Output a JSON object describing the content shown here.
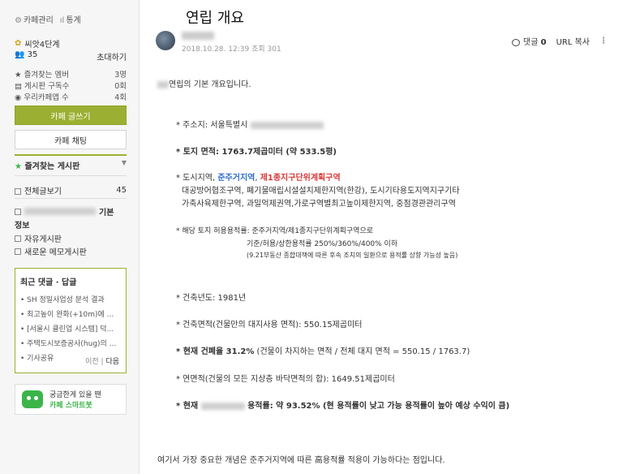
{
  "sidebar": {
    "cafe_manage": "카페관리",
    "stats": "통계",
    "level": "씨앗4단계",
    "member_count": "35",
    "invite": "초대하기",
    "stats_rows": [
      {
        "label": "즐겨찾는 멤버",
        "value": "3명"
      },
      {
        "label": "게시판 구독수",
        "value": "0회"
      },
      {
        "label": "우리카페앱 수",
        "value": "4회"
      }
    ],
    "write_btn": "카페 글쓰기",
    "chat_btn": "카페 채팅",
    "fav_boards": "즐겨찾는 게시판",
    "all_posts": "전체글보기",
    "all_posts_count": "45",
    "board_basic": "기본",
    "board_info": "정보",
    "board_free": "자유게시판",
    "board_memo": "새로운 메모게시판",
    "recent_title": "최근 댓글 · 답글",
    "recent_items": [
      "SH 정밀사업성 분석 결과",
      "최고높이 완화(+10m)에 ...",
      "[서울시 클린업 시스템] 덕...",
      "주택도시보증공사(hug)의 ...",
      "기사공유"
    ],
    "prev": "이전",
    "next": "다음",
    "smart_line1": "궁금한게 있을 땐",
    "smart_line2": "카페 스마트봇",
    "accent": "#9bb032"
  },
  "post": {
    "title": "연립 개요",
    "date": "2018.10.28. 12:39",
    "views": "조회 301",
    "comment_label": "댓글",
    "comment_count": "0",
    "url_copy": "URL 복사",
    "intro": "연립의 기본 개요입니다.",
    "addr": "* 주소지: 서울특별시",
    "land_area": "* 토지 면적: 1763.7제곱미터 (약 533.5평)",
    "zone_prefix": "* 도시지역, ",
    "zone_blue": "준주거지역",
    "zone_red": "제1종지구단위계획구역",
    "zone_line2": "대공방어협조구역, 폐기물매립시설설치제한지역(한강), 도시기타용도지역지구기타",
    "zone_line3": "가축사육제한구역, 과밀억제권역,가로구역별최고높이제한지역, 중점경관관리구역",
    "far_line1": "* 해당 토지 허용용적률: 준주거지역/제1종지구단위계획구역으로",
    "far_line2": "기준/허용/상한용적률 250%/360%/400% 이하",
    "far_line3": "(9.21부동산 종합대책에 따른 후속 조치의 일환으로 용적률 상향 가능성 높음)",
    "built_year": "* 건축년도: 1981년",
    "building_area": "* 건축면적(건물만의 대지사용 면적): 550.15제곱미터",
    "bcr_bold": "* 현재 건폐율 31.2%",
    "bcr_rest": " (건물이 차지하는 면적 / 전체 대지 면적 = 550.15 / 1763.7)",
    "gfa": "* 연면적(건물의 모든 지상층 바닥면적의 합): 1649.51제곱미터",
    "far_now_prefix": "* 현재",
    "far_now_rest": "용적률: 약 93.52% (현 용적률이 낮고 가능 용적률이 높아 예상 수익이 큼)",
    "conclusion": "여기서 가장 중요한 개념은 준주거지역에 따른 高용적률 적용이 가능하다는 점입니다."
  }
}
